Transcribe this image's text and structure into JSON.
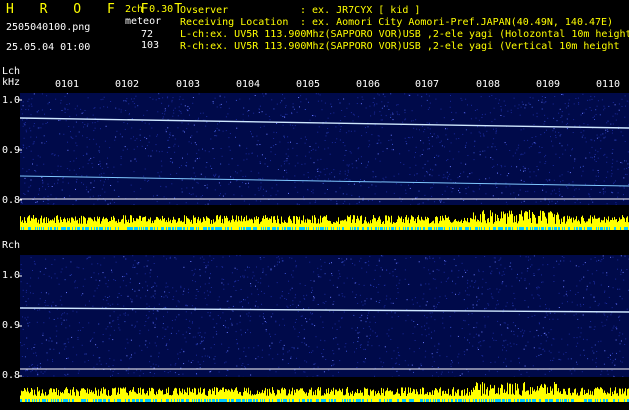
{
  "header": {
    "app_title": "H R O F F T",
    "channel_version": "2ch 0.30",
    "filename": "2505040100.png",
    "datetime": "25.05.04 01:00",
    "meteor_label": "meteor",
    "meteor_count_l": "72",
    "meteor_count_r": "103",
    "observer_label": "Ovserver",
    "observer_value": ": ex. JR7CYX [ kid ]",
    "location_label": "Receiving Location",
    "location_value": ": ex. Aomori City Aomori-Pref.JAPAN(40.49N, 140.47E)",
    "lch_info": "L-ch:ex. UV5R 113.900Mhz(SAPPORO VOR)USB ,2-ele yagi (Holozontal 10m height",
    "rch_info": "R-ch:ex. UV5R 113.900Mhz(SAPPORO VOR)USB ,2-ele yagi (Vertical 10m height"
  },
  "lch": {
    "label": "Lch",
    "unit": "kHz",
    "ticks": [
      "1.0",
      "0.9",
      "0.8"
    ],
    "time_labels": [
      "0101",
      "0102",
      "0103",
      "0104",
      "0105",
      "0106",
      "0107",
      "0108",
      "0109",
      "0110"
    ]
  },
  "rch": {
    "label": "Rch",
    "ticks": [
      "1.0",
      "0.9",
      "0.8"
    ]
  },
  "colors": {
    "text_yellow": "#ffff00",
    "text_cyan": "#00ffff",
    "noise_bg": "#000a4a",
    "signal_line": "#cfe8ff",
    "meter_yellow": "#ffff00",
    "meter_cyan": "#00c8ff"
  }
}
